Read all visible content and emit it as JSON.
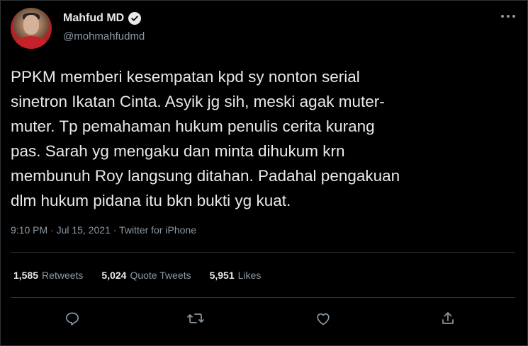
{
  "tweet": {
    "author": {
      "name": "Mahfud MD",
      "handle": "@mohmahfudmd",
      "verified": true,
      "avatar_icon": "profile-photo"
    },
    "text": "PPKM memberi kesempatan kpd sy nonton serial sinetron Ikatan Cinta. Asyik jg sih, meski agak muter-muter. Tp pemahaman hukum penulis cerita kurang pas. Sarah yg mengaku dan minta dihukum krn membunuh Roy langsung ditahan. Padahal pengakuan dlm hukum pidana itu bkn bukti yg kuat.",
    "lines": [
      "PPKM memberi kesempatan kpd sy nonton serial",
      "sinetron Ikatan Cinta. Asyik jg sih, meski agak muter-",
      "muter. Tp pemahaman hukum penulis cerita kurang",
      "pas. Sarah yg mengaku dan minta dihukum krn",
      "membunuh Roy langsung ditahan. Padahal pengakuan",
      "dlm hukum pidana itu bkn bukti yg kuat."
    ],
    "timestamp": "9:10 PM · Jul 15, 2021 · Twitter for iPhone",
    "stats": {
      "retweets": {
        "count": "1,585",
        "label": "Retweets"
      },
      "quote_tweets": {
        "count": "5,024",
        "label": "Quote Tweets"
      },
      "likes": {
        "count": "5,951",
        "label": "Likes"
      }
    },
    "actions": [
      "reply-icon",
      "retweet-icon",
      "like-icon",
      "share-icon"
    ]
  },
  "colors": {
    "background": "#000000",
    "text": "#e7e9ea",
    "secondary": "#8b98a5",
    "divider": "#2f3336"
  }
}
